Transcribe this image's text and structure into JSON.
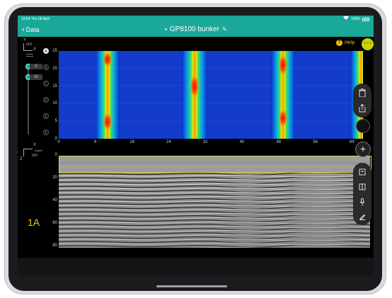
{
  "status_bar": {
    "time": "19:54 Thu 08 April",
    "battery": "100%"
  },
  "nav": {
    "back_label": "Data",
    "title": "GP8100 bunker"
  },
  "help_label": "Help",
  "yellow_button_label": "• • •",
  "plan_view": {
    "axis_unit_y": "cm",
    "axis_letters": {
      "y": "Y",
      "x": "X"
    },
    "rows": [
      "A",
      "B",
      "C",
      "D",
      "E",
      "F"
    ],
    "active_row": "A",
    "y_ticks": [
      "25",
      "20",
      "15",
      "10",
      "5",
      "0"
    ],
    "x_ticks": [
      "0",
      "8",
      "16",
      "24",
      "32",
      "40",
      "48",
      "56",
      "64"
    ],
    "slider_values": {
      "top": "0",
      "bottom": "16"
    }
  },
  "profile_view": {
    "depth_label": "Depth",
    "unit": "cm",
    "axis_letters": {
      "z": "Z",
      "x": "X"
    },
    "depth_ticks": [
      "0",
      "20",
      "40",
      "60",
      "80"
    ],
    "line_label": "1A"
  },
  "colors": {
    "accent": "#1aa899",
    "highlight": "#f5c400",
    "selection": "#e0d34a"
  },
  "tools": {
    "top": [
      "trash-icon",
      "share-icon"
    ],
    "bottom": [
      "flag-icon",
      "split-view-icon",
      "microphone-icon",
      "pen-icon"
    ]
  }
}
